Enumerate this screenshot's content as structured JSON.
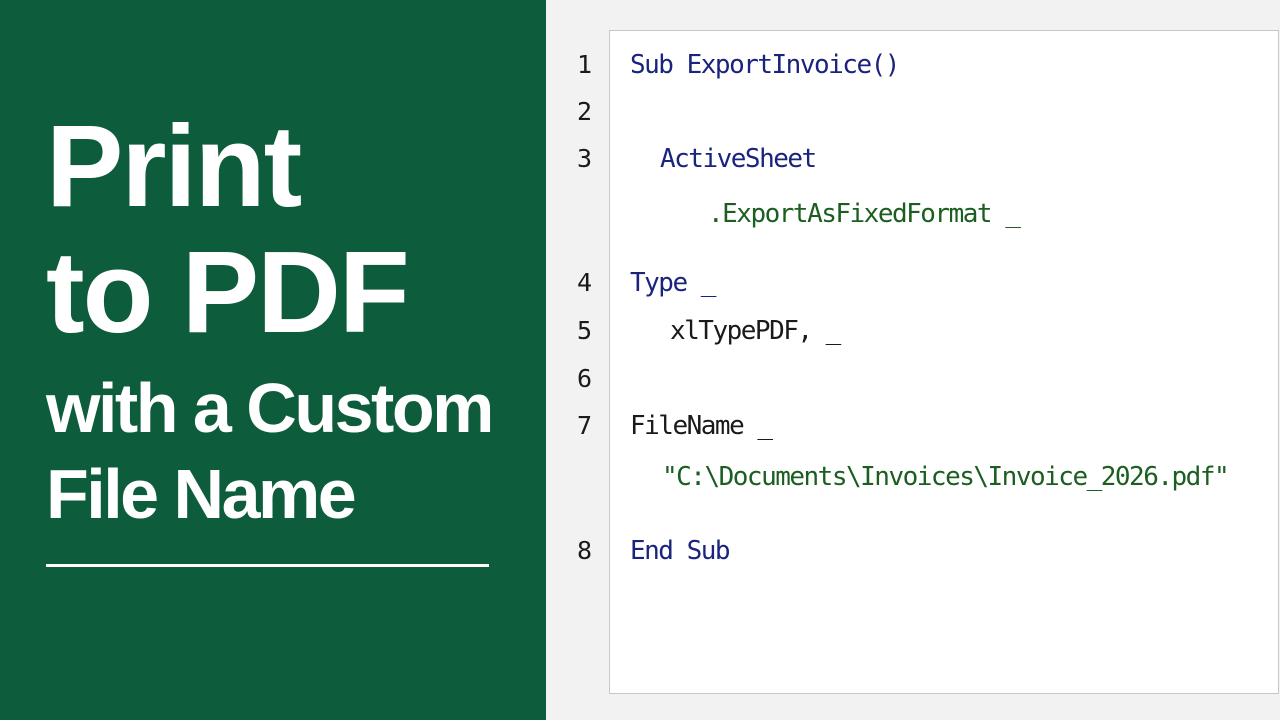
{
  "title": {
    "line1": "Print",
    "line2": "to PDF",
    "line3": "with a Custom",
    "line4": "File Name"
  },
  "code": {
    "lines": [
      {
        "number": "1",
        "text": "Sub ExportInvoice()"
      },
      {
        "number": "2",
        "text": ""
      },
      {
        "number": "3",
        "text": "ActiveSheet"
      },
      {
        "number": "",
        "text": ".ExportAsFixedFormat _"
      },
      {
        "number": "4",
        "text": "Type _"
      },
      {
        "number": "5",
        "text": "xlTypePDF, _"
      },
      {
        "number": "6",
        "text": ""
      },
      {
        "number": "7",
        "text": "FileName _"
      },
      {
        "number": "",
        "text": "\"C:\\Documents\\Invoices\\Invoice_2026.pdf\""
      },
      {
        "number": "8",
        "text": "End Sub"
      }
    ]
  },
  "colors": {
    "panel_green": "#0d5c3b",
    "keyword_blue": "#1a237e",
    "code_green": "#1b5e20"
  }
}
